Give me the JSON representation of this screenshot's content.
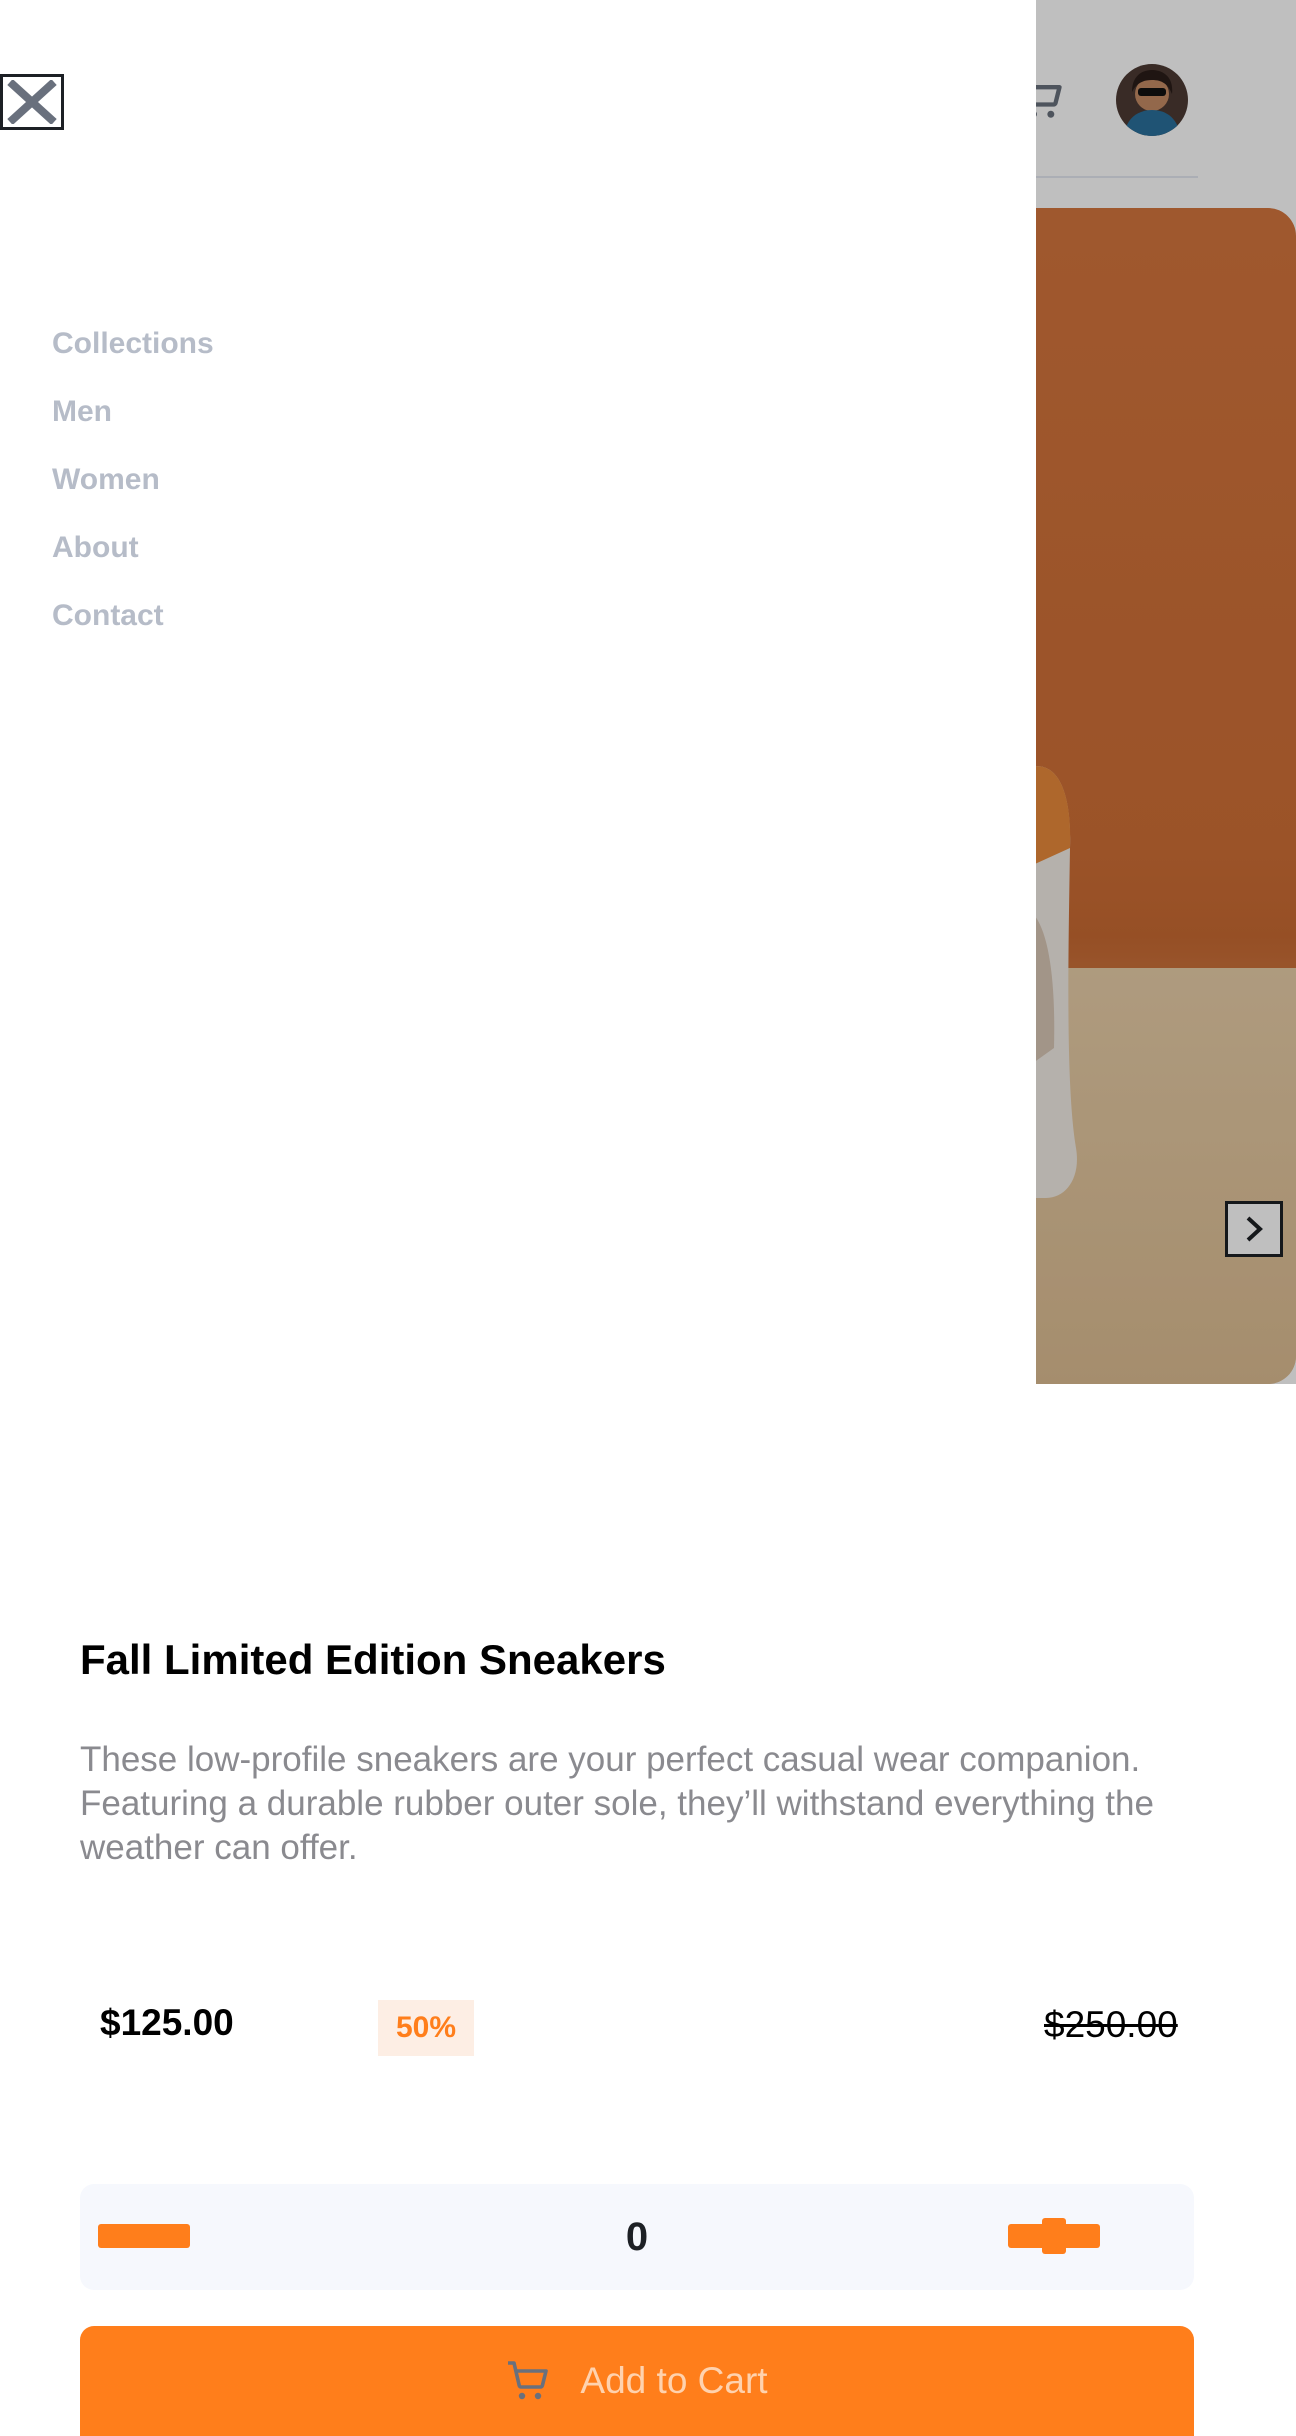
{
  "menu": {
    "items": [
      {
        "label": "Collections"
      },
      {
        "label": "Men"
      },
      {
        "label": "Women"
      },
      {
        "label": "About"
      },
      {
        "label": "Contact"
      }
    ]
  },
  "product": {
    "title": "Fall Limited Edition Sneakers",
    "description": "These low-profile sneakers are your perfect casual wear companion. Featuring a durable rubber outer sole, they’ll withstand everything the weather can offer.",
    "price": "$125.00",
    "discount": "50%",
    "original_price": "$250.00"
  },
  "quantity": {
    "value": "0"
  },
  "add_to_cart": {
    "label": "Add to Cart"
  },
  "icons": {
    "close": "close-icon",
    "cart": "cart-icon",
    "next": "chevron-right-icon",
    "minus": "minus-icon",
    "plus": "plus-icon"
  },
  "colors": {
    "accent": "#ff7e1b",
    "accent_pale": "#fdeee4",
    "menu_text": "#b6bcc8",
    "body_text": "#8a8a8f"
  }
}
